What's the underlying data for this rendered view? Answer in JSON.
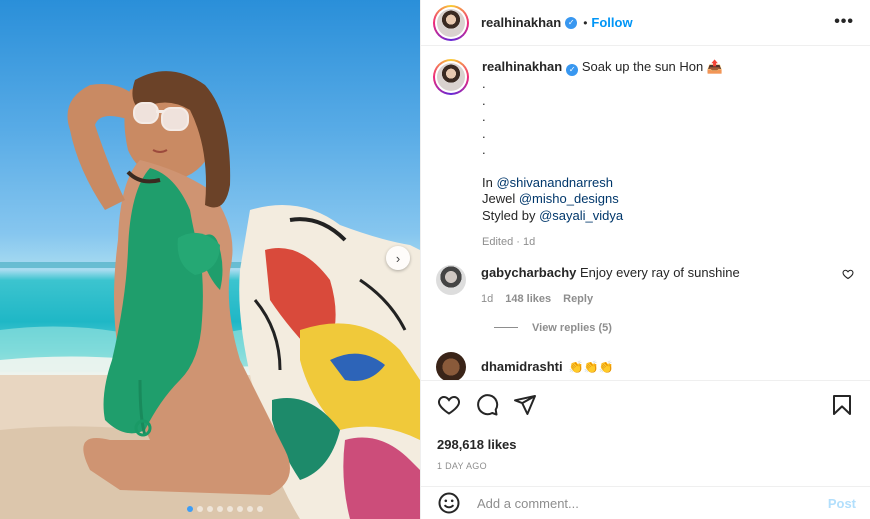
{
  "post": {
    "author": "realhinakhan",
    "follow_label": "Follow",
    "separator": "•",
    "more_label": "•••",
    "verified_mark": "✓",
    "caption": {
      "text": "Soak up the sun Hon",
      "emoji": "📤",
      "dots": [
        ".",
        ".",
        ".",
        ".",
        "."
      ],
      "in_prefix": "In ",
      "in_mention": "@shivanandnarresh",
      "jewel_prefix": "Jewel ",
      "jewel_mention": "@misho_designs",
      "styled_prefix": "Styled by ",
      "styled_mention": "@sayali_vidya",
      "edited": "Edited · 1d"
    },
    "comments": [
      {
        "user": "gabycharbachy",
        "text": "Enjoy every ray of sunshine",
        "age": "1d",
        "likes": "148 likes",
        "reply_label": "Reply",
        "view_replies": "View replies (5)"
      },
      {
        "user": "dhamidrashti",
        "text": "👏👏👏"
      }
    ],
    "likes": "298,618 likes",
    "date": "1 DAY AGO",
    "add_comment_placeholder": "Add a comment...",
    "post_label": "Post",
    "carousel": {
      "count": 8,
      "active_index": 0,
      "next_label": "›"
    }
  },
  "icons": {
    "like": "heart-icon",
    "comment": "comment-icon",
    "share": "share-icon",
    "save": "bookmark-icon",
    "emoji": "emoji-icon",
    "more": "more-options-icon"
  },
  "colors": {
    "link": "#0095f6",
    "mention": "#00376b",
    "muted": "#8e8e8e",
    "post_disabled": "#b2dffc"
  }
}
